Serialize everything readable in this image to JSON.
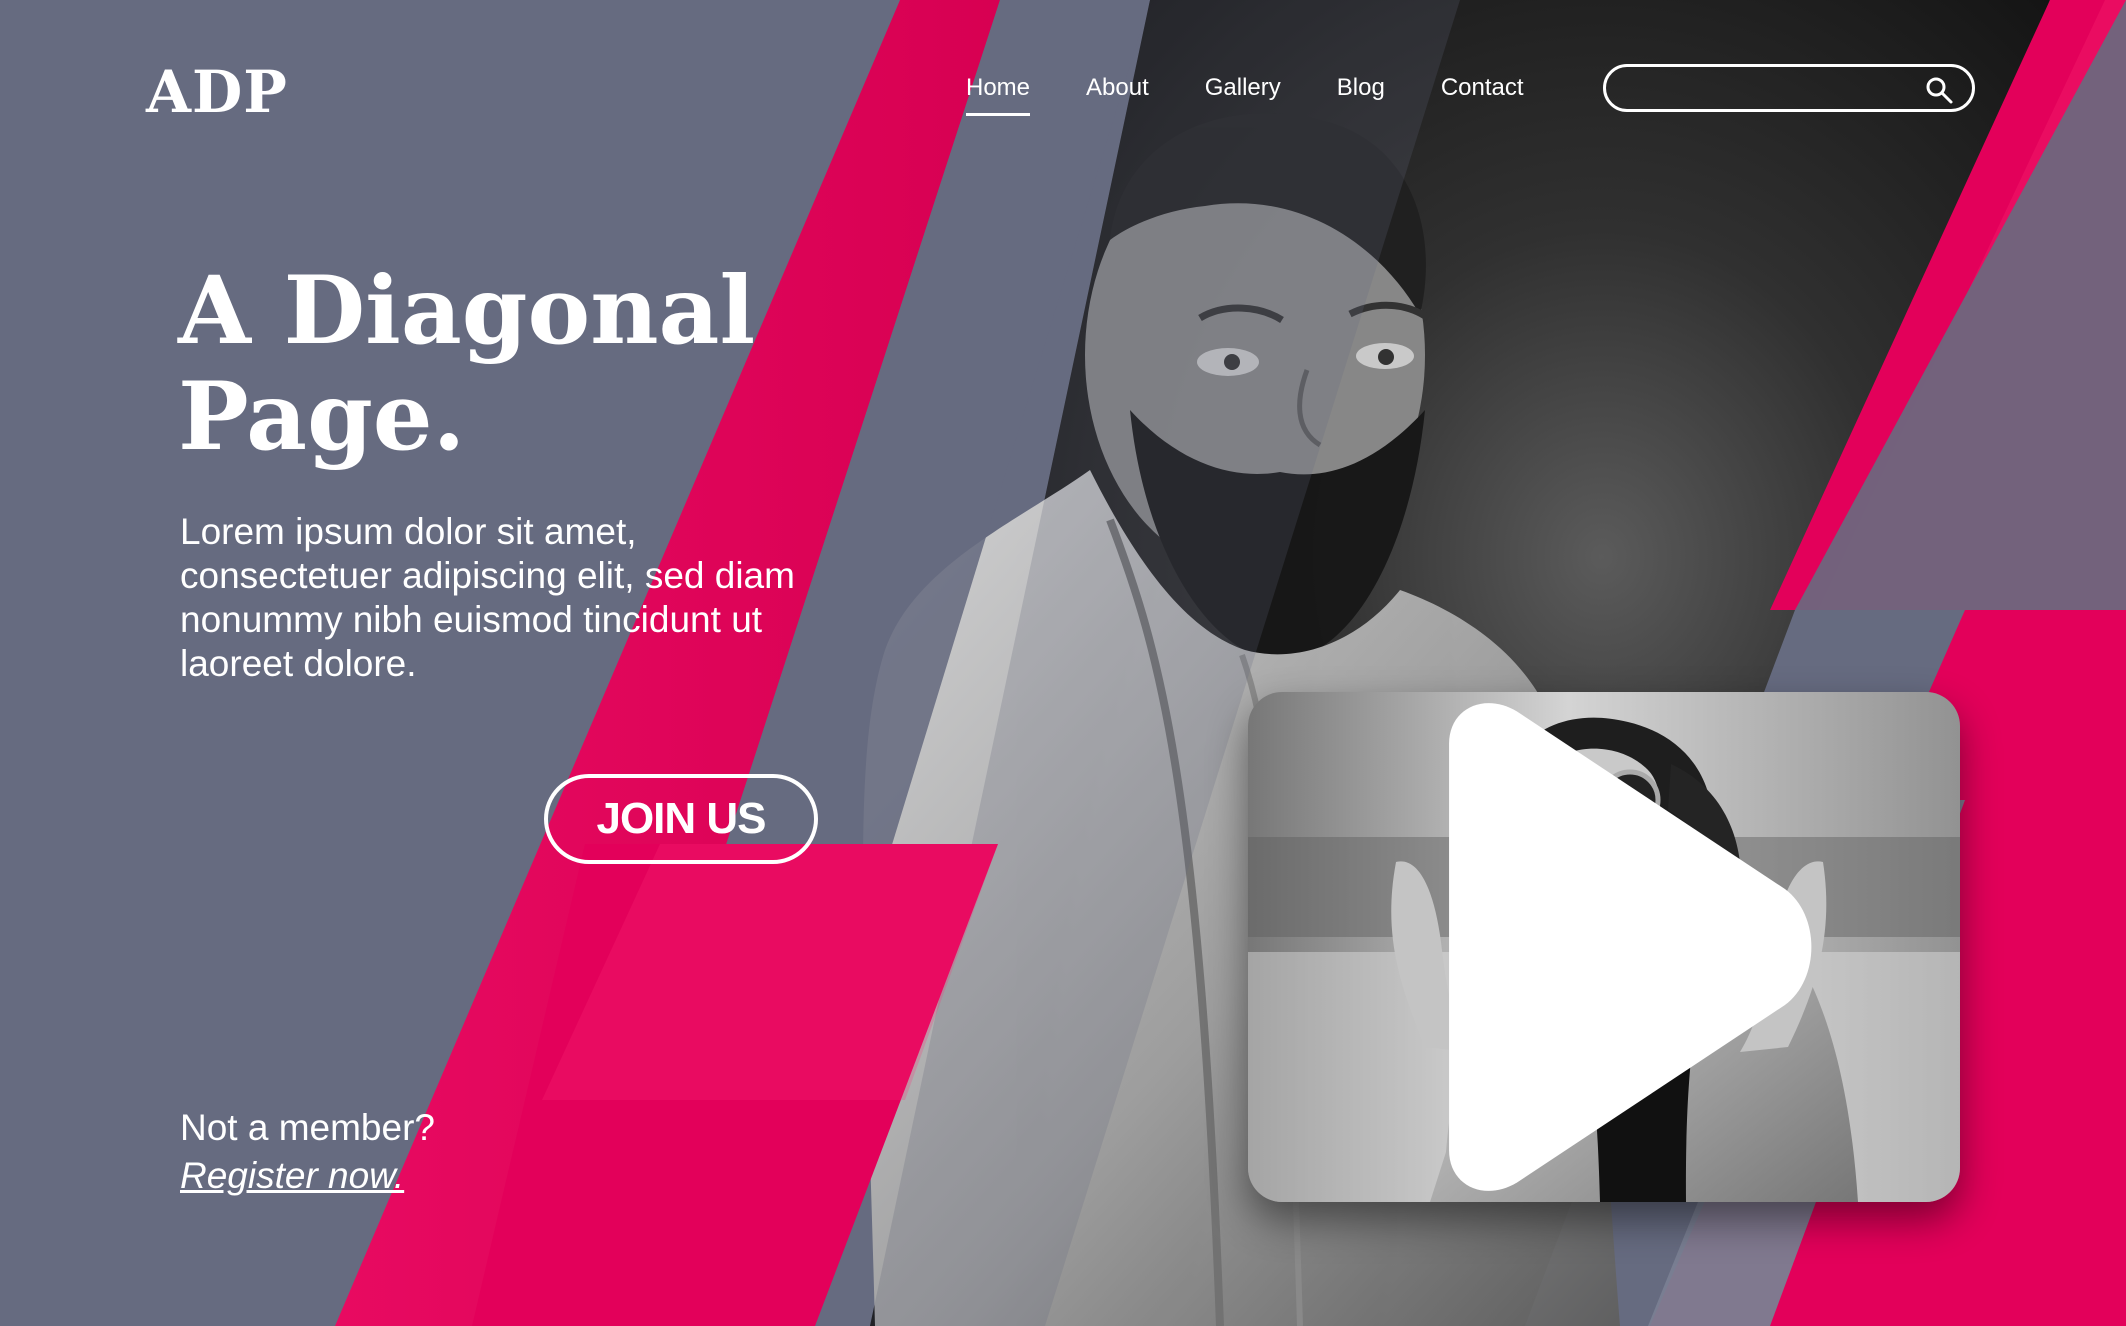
{
  "logo": "ADP",
  "nav": {
    "items": [
      "Home",
      "About",
      "Gallery",
      "Blog",
      "Contact"
    ],
    "active": "Home"
  },
  "search": {
    "placeholder": "",
    "icon": "search-icon"
  },
  "hero": {
    "title_line1": "A Diagonal",
    "title_line2": "Page.",
    "text": "Lorem ipsum dolor sit amet, consectetuer adipiscing elit, sed diam nonummy nibh euismod tincidunt ut laoreet dolore.",
    "cta": "JOIN US"
  },
  "membership": {
    "question": "Not a member?",
    "link": "Register now."
  },
  "video": {
    "icon": "play-icon"
  },
  "colors": {
    "background": "#666b80",
    "accent": "#e3005a",
    "dark": "#111111",
    "text": "#ffffff"
  }
}
